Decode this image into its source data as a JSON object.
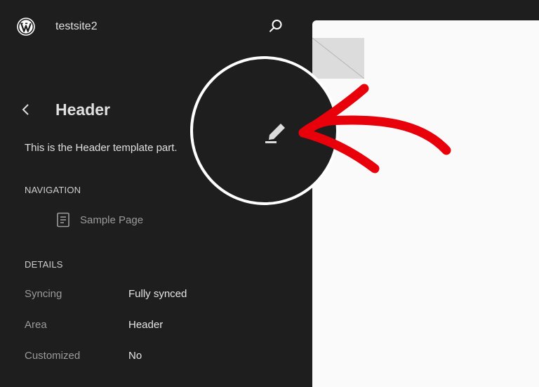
{
  "header": {
    "site_title": "testsite2",
    "logo_icon": "wordpress-logo-icon",
    "search_icon": "search-icon"
  },
  "panel": {
    "title": "Header",
    "back_icon": "chevron-left-icon",
    "description": "This is the Header template part.",
    "edit_icon": "pencil-icon"
  },
  "navigation": {
    "label": "NAVIGATION",
    "items": [
      {
        "label": "Sample Page",
        "icon": "page-icon"
      }
    ]
  },
  "details": {
    "label": "DETAILS",
    "rows": [
      {
        "key": "Syncing",
        "value": "Fully synced"
      },
      {
        "key": "Area",
        "value": "Header"
      },
      {
        "key": "Customized",
        "value": "No"
      }
    ]
  },
  "annotation": {
    "arrow_color": "#e8000b",
    "circle_color": "#ffffff"
  }
}
